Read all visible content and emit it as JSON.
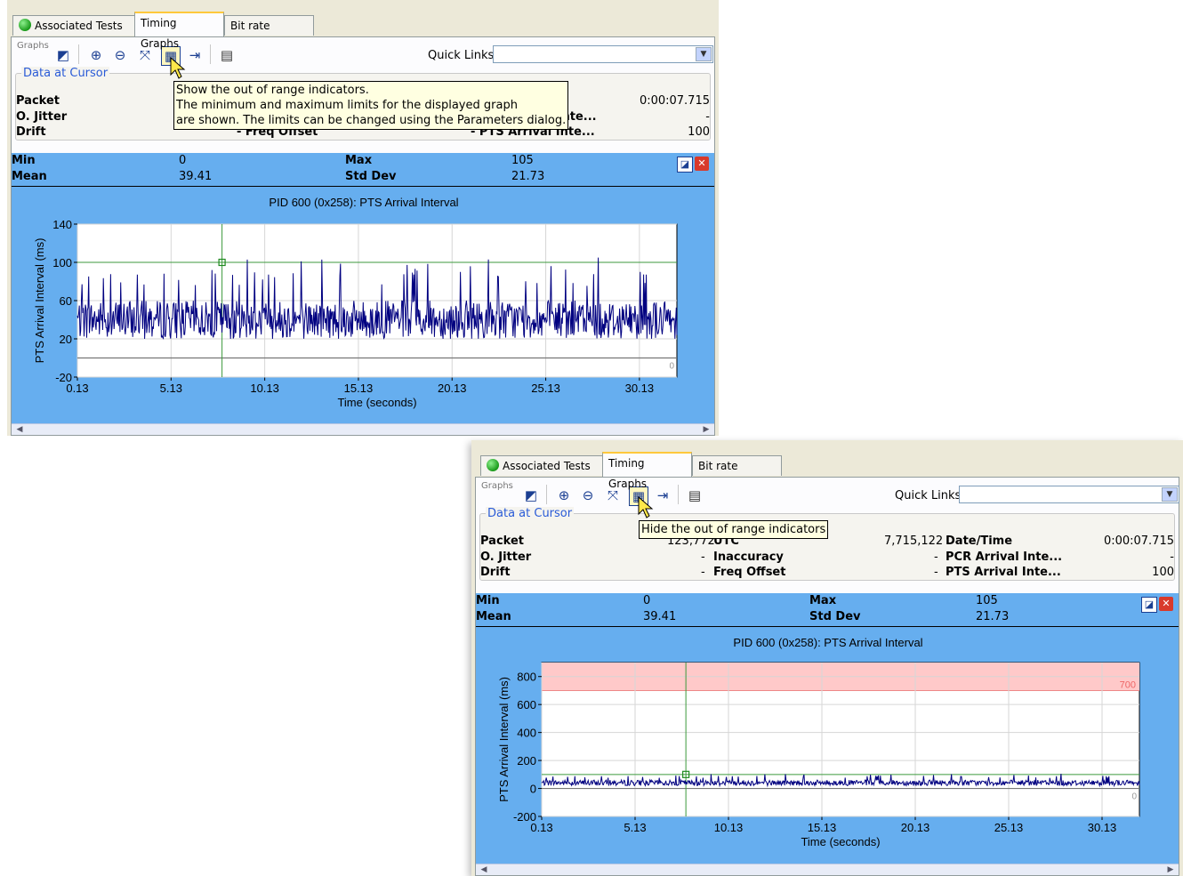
{
  "tabs": {
    "associated": "Associated Tests",
    "timing": "Timing Graphs",
    "bitrate": "Bit rate Graphs"
  },
  "toolbar": {
    "graphs_label": "Graphs",
    "quick_links_label": "Quick Links",
    "quick_links_value": "",
    "icons": [
      "graph-select-icon",
      "zoom-in-icon",
      "zoom-out-icon",
      "zoom-fit-icon",
      "range-indicators-icon",
      "export-icon",
      "table-icon"
    ]
  },
  "data_at_cursor": {
    "title": "Data at Cursor",
    "rows": [
      {
        "label1": "Packet",
        "value1": "123,772",
        "label2": "UTC",
        "value2": "7,715,122",
        "label3": "Date/Time",
        "value3": "0:00:07.715"
      },
      {
        "label1": "O. Jitter",
        "value1": "-",
        "label2": "Inaccuracy",
        "value2": "-",
        "label3": "PCR Arrival Inte...",
        "value3": "-"
      },
      {
        "label1": "Drift",
        "value1": "-",
        "label2": "Freq Offset",
        "value2": "-",
        "label3": "PTS Arrival Inte...",
        "value3": "100"
      }
    ]
  },
  "stats": {
    "min_label": "Min",
    "min": "0",
    "max_label": "Max",
    "max": "105",
    "mean_label": "Mean",
    "mean": "39.41",
    "std_label": "Std Dev",
    "std": "21.73"
  },
  "panel1": {
    "tooltip": [
      "Show the out of range indicators.",
      "The minimum and maximum limits for the displayed graph",
      "are shown. The limits can be changed using the Parameters dialog."
    ],
    "visible_labels": {
      "time_fragment": "me",
      "pcr_fragment": "ival Inte...",
      "pts_fragment": "- PTS Arrival Inte...",
      "freq_fragment": "- Freq Offset"
    }
  },
  "panel2": {
    "tooltip": [
      "Hide the out of range indicators"
    ]
  },
  "chart_data": [
    {
      "type": "line",
      "title": "PID 600 (0x258): PTS Arrival Interval",
      "xlabel": "Time (seconds)",
      "ylabel": "PTS Arrival Interval (ms)",
      "xlim": [
        0.13,
        32.13
      ],
      "ylim": [
        -20,
        140
      ],
      "xticks": [
        "0.13",
        "5.13",
        "10.13",
        "15.13",
        "20.13",
        "25.13",
        "30.13"
      ],
      "yticks": [
        "-20",
        "20",
        "60",
        "100",
        "140"
      ],
      "cursor_x": 7.85,
      "cursor_y": 100,
      "lower_limit": 0,
      "lower_limit_label": "0",
      "series": [
        {
          "color": "#000080",
          "typical_range": [
            20,
            60
          ],
          "peaks_max": 105
        }
      ],
      "grid": true
    },
    {
      "type": "line",
      "title": "PID 600 (0x258): PTS Arrival Interval",
      "xlabel": "Time (seconds)",
      "ylabel": "PTS Arrival Interval (ms)",
      "xlim": [
        0.13,
        32.13
      ],
      "ylim": [
        -200,
        900
      ],
      "xticks": [
        "0.13",
        "5.13",
        "10.13",
        "15.13",
        "20.13",
        "25.13",
        "30.13"
      ],
      "yticks": [
        "-200",
        "0",
        "200",
        "400",
        "600",
        "800"
      ],
      "cursor_x": 7.85,
      "cursor_y": 100,
      "out_of_range_above": 700,
      "out_of_range_label": "700",
      "lower_limit": 0,
      "lower_limit_label": "0",
      "series": [
        {
          "color": "#000080",
          "typical_range": [
            20,
            60
          ],
          "peaks_max": 105
        }
      ],
      "grid": true
    }
  ]
}
